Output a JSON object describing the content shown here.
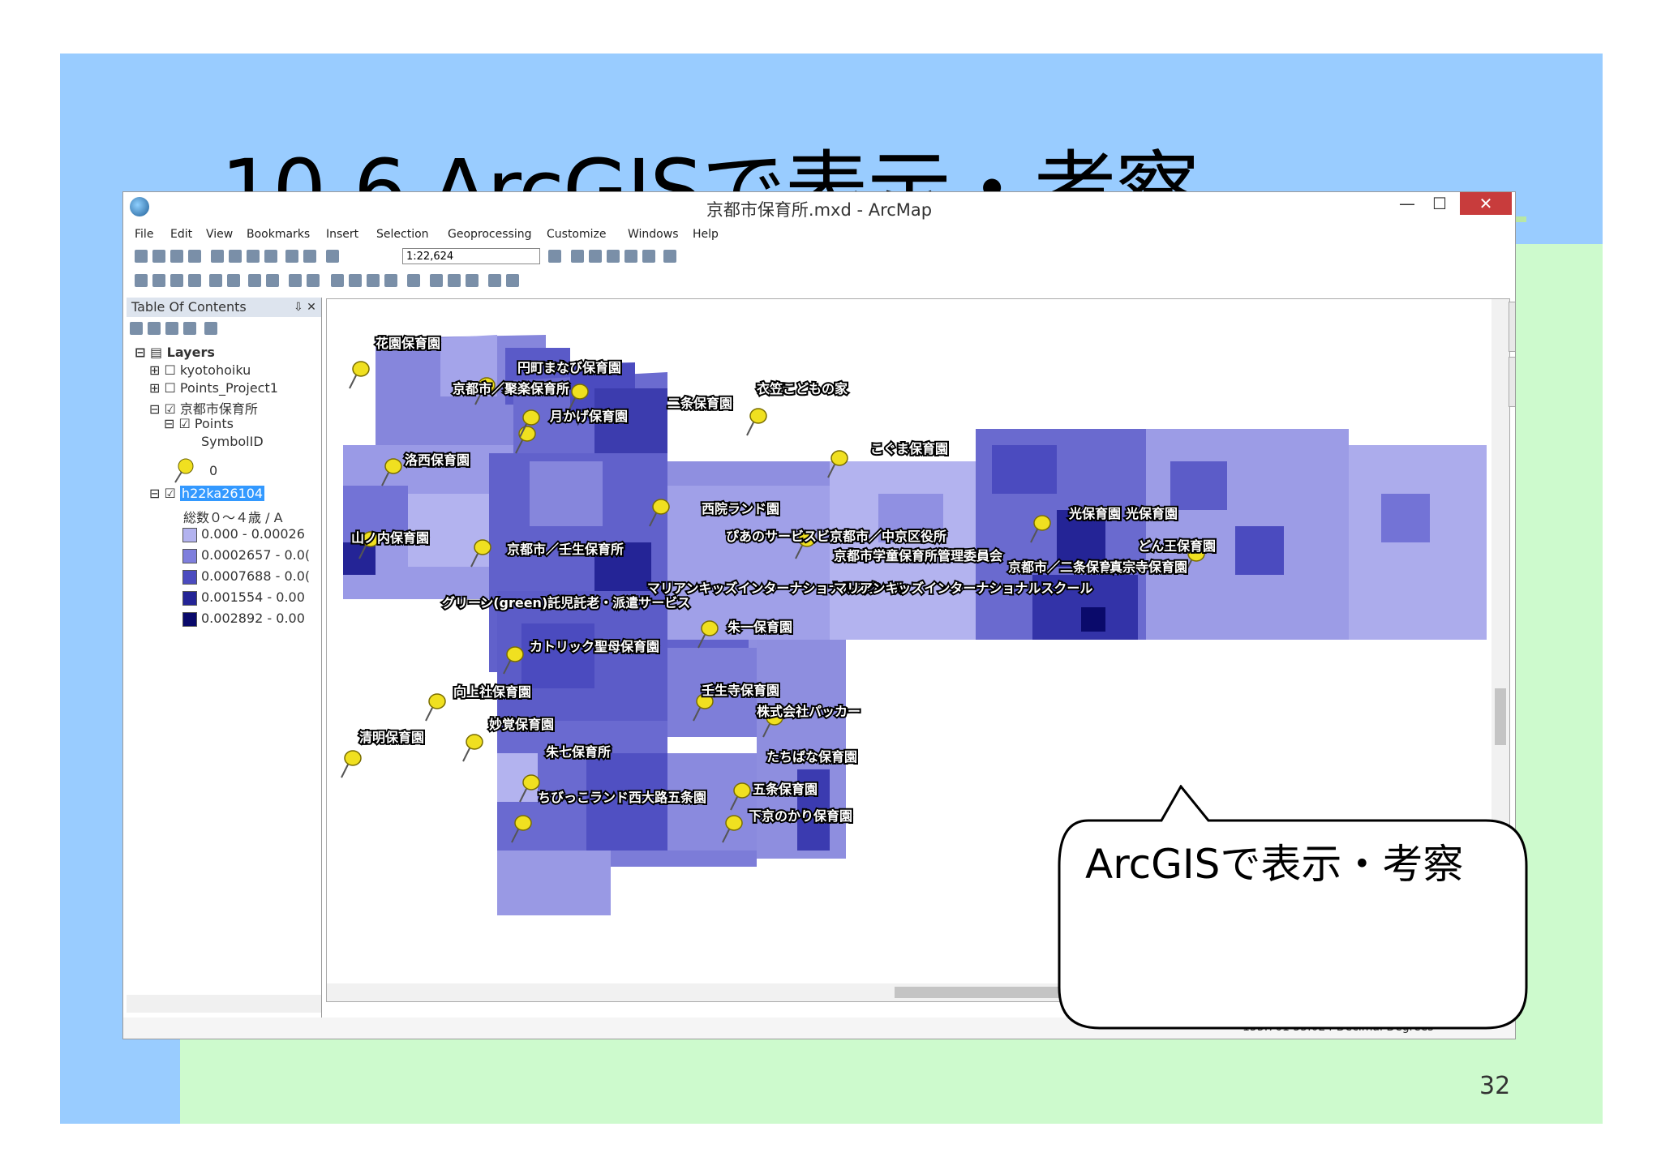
{
  "slide": {
    "title": "10-6 ArcGISで表示・考察",
    "number": "32",
    "callout_text": "ArcGISで表示・考察"
  },
  "window": {
    "title": "京都市保育所.mxd - ArcMap",
    "minimize": "—",
    "maximize": "☐",
    "close": "✕"
  },
  "menu": [
    "File",
    "Edit",
    "View",
    "Bookmarks",
    "Insert",
    "Selection",
    "Geoprocessing",
    "Customize",
    "Windows",
    "Help"
  ],
  "toolbar": {
    "scale": "1:22,624"
  },
  "toc": {
    "header": "Table Of Contents",
    "pin": "⇩ ✕",
    "layers_root": "Layers",
    "items": [
      "kyotohoiku",
      "Points_Project1",
      "京都市保育所",
      "Points",
      "SymbolID",
      "0",
      "h22ka26104",
      "総数０～４歳 / A"
    ],
    "classes": [
      {
        "label": "0.000 - 0.00026",
        "color": "#b3b3ef"
      },
      {
        "label": "0.0002657 - 0.0(",
        "color": "#7f7fdd"
      },
      {
        "label": "0.0007688 - 0.0(",
        "color": "#4b4bbf"
      },
      {
        "label": "0.001554 - 0.00",
        "color": "#242496"
      },
      {
        "label": "0.002892 - 0.00",
        "color": "#0a0a6b"
      }
    ]
  },
  "map": {
    "labels": [
      "花園保育園",
      "円町まなび保育園",
      "京都市／聚楽保育所",
      "月かげ保育園",
      "二条保育園",
      "衣笠こどもの家",
      "洛西保育園",
      "こぐま保育園",
      "西院ランド園",
      "光保育園",
      "光保育園",
      "山ノ内保育園",
      "京都市／壬生保育所",
      "ぴあのサービスビキオ",
      "京都市／中京区役所",
      "京都市学童保育所管理委員会",
      "京都市／二条保育所",
      "真宗寺保育園",
      "どん王保育園",
      "マリアンキッズインターナショナルスクール",
      "マリアンキッズインターナショナルスクール",
      "グリーン(green)託児託老・派遣サービス",
      "朱一保育園",
      "カトリック聖母保育園",
      "壬生寺保育園",
      "向上社保育園",
      "株式会社パッカー",
      "妙覚保育園",
      "清明保育園",
      "朱七保育所",
      "たちばな保育園",
      "五条保育園",
      "ちびっこランド西大路五条園",
      "下京のかり保育園"
    ]
  },
  "status": {
    "coords": "135.761  35.024 Decimal Degrees"
  },
  "colors": {
    "slide_blue": "#99ccff",
    "slide_green": "#cdfacd",
    "class1": "#b3b3ef",
    "class5": "#0a0a6b",
    "pin": "#f0e020"
  }
}
